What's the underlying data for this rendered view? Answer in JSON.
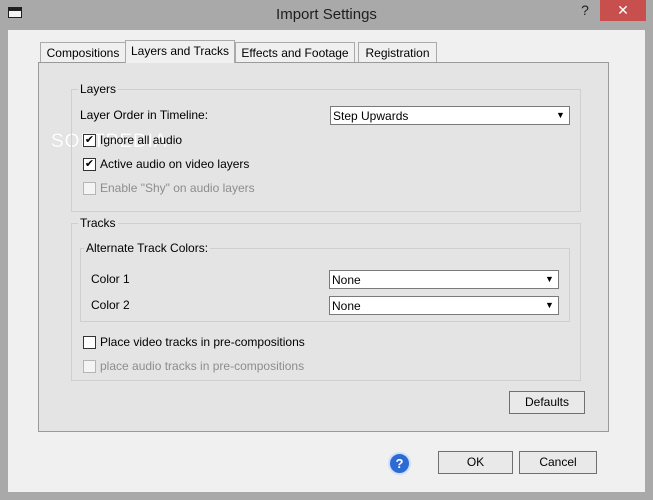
{
  "window": {
    "title": "Import Settings",
    "help_glyph": "?",
    "close_glyph": "✕"
  },
  "tabs": [
    {
      "label": "Compositions"
    },
    {
      "label": "Layers and Tracks"
    },
    {
      "label": "Effects and Footage"
    },
    {
      "label": "Registration"
    }
  ],
  "watermark": "SOFTPEDIA",
  "layers": {
    "group_label": "Layers",
    "order_label": "Layer Order in Timeline:",
    "order_value": "Step Upwards",
    "ignore_audio": {
      "label": "Ignore all audio",
      "checked": true
    },
    "active_audio": {
      "label": "Active audio on video layers",
      "checked": true
    },
    "shy": {
      "label": "Enable \"Shy\" on audio layers",
      "checked": false,
      "disabled": true
    }
  },
  "tracks": {
    "group_label": "Tracks",
    "alt_label": "Alternate Track Colors:",
    "color1_label": "Color 1",
    "color1_value": "None",
    "color2_label": "Color 2",
    "color2_value": "None",
    "video_precomp": {
      "label": "Place video tracks in pre-compositions",
      "checked": false
    },
    "audio_precomp": {
      "label": "place audio tracks in pre-compositions",
      "checked": false,
      "disabled": true
    }
  },
  "buttons": {
    "defaults": "Defaults",
    "ok": "OK",
    "cancel": "Cancel",
    "help": "?"
  },
  "glyphs": {
    "check": "✔",
    "arrow": "▼"
  }
}
